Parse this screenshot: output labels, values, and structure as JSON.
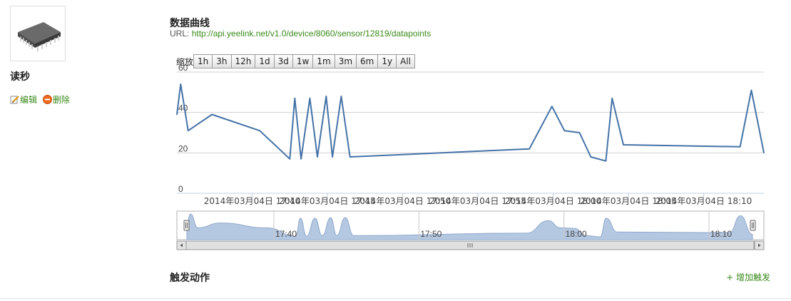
{
  "sensor": {
    "name": "读秒",
    "icon": "chip-icon",
    "edit_label": "编辑",
    "delete_label": "删除"
  },
  "section": {
    "title": "数据曲线",
    "url_label": "URL:",
    "url": "http://api.yeelink.net/v1.0/device/8060/sensor/12819/datapoints"
  },
  "zoom": {
    "label": "缩放",
    "buttons": [
      "1h",
      "3h",
      "12h",
      "1d",
      "3d",
      "1w",
      "1m",
      "3m",
      "6m",
      "1y",
      "All"
    ]
  },
  "triggers": {
    "title": "触发动作",
    "add_label": "+ 增加触发"
  },
  "colors": {
    "line": "#4572a7",
    "navigator_fill": "#b5c8e1",
    "link": "#3a8a1c"
  },
  "chart_data": {
    "type": "line",
    "ylim": [
      0,
      60
    ],
    "yticks": [
      0,
      20,
      40,
      60
    ],
    "xlim": [
      "17:33",
      "18:12"
    ],
    "x_tick_labels": [
      "2014年03月04日 17:40",
      "2014年03月04日 17:45",
      "2014年03月04日 17:50",
      "2014年03月04日 17:55",
      "2014年03月04日 18:00",
      "2014年03月04日 18:05",
      "2014年03月04日 18:10"
    ],
    "x_tick_times": [
      "17:38",
      "17:43",
      "17:48",
      "17:53",
      "17:58",
      "18:03",
      "18:08"
    ],
    "series": [
      {
        "points": [
          [
            "17:33:00",
            39
          ],
          [
            "17:33:15",
            54
          ],
          [
            "17:33:45",
            31
          ],
          [
            "17:35:20",
            39
          ],
          [
            "17:38:30",
            31
          ],
          [
            "17:40:30",
            17
          ],
          [
            "17:40:50",
            47
          ],
          [
            "17:41:15",
            17
          ],
          [
            "17:41:50",
            47
          ],
          [
            "17:42:20",
            18
          ],
          [
            "17:42:55",
            48
          ],
          [
            "17:43:20",
            18
          ],
          [
            "17:43:55",
            48
          ],
          [
            "17:44:30",
            18
          ],
          [
            "17:56:25",
            22
          ],
          [
            "17:57:55",
            43
          ],
          [
            "17:58:45",
            31
          ],
          [
            "17:59:45",
            30
          ],
          [
            "18:00:30",
            18
          ],
          [
            "18:01:30",
            16
          ],
          [
            "18:01:55",
            47
          ],
          [
            "18:02:40",
            24
          ],
          [
            "18:10:25",
            23
          ],
          [
            "18:11:10",
            51
          ],
          [
            "18:12:00",
            20
          ]
        ]
      }
    ],
    "navigator": {
      "tick_labels": [
        "17:40",
        "17:50",
        "18:00",
        "18:10"
      ],
      "tick_times": [
        "17:39",
        "17:49",
        "17:59",
        "18:09"
      ]
    },
    "grid": true
  }
}
